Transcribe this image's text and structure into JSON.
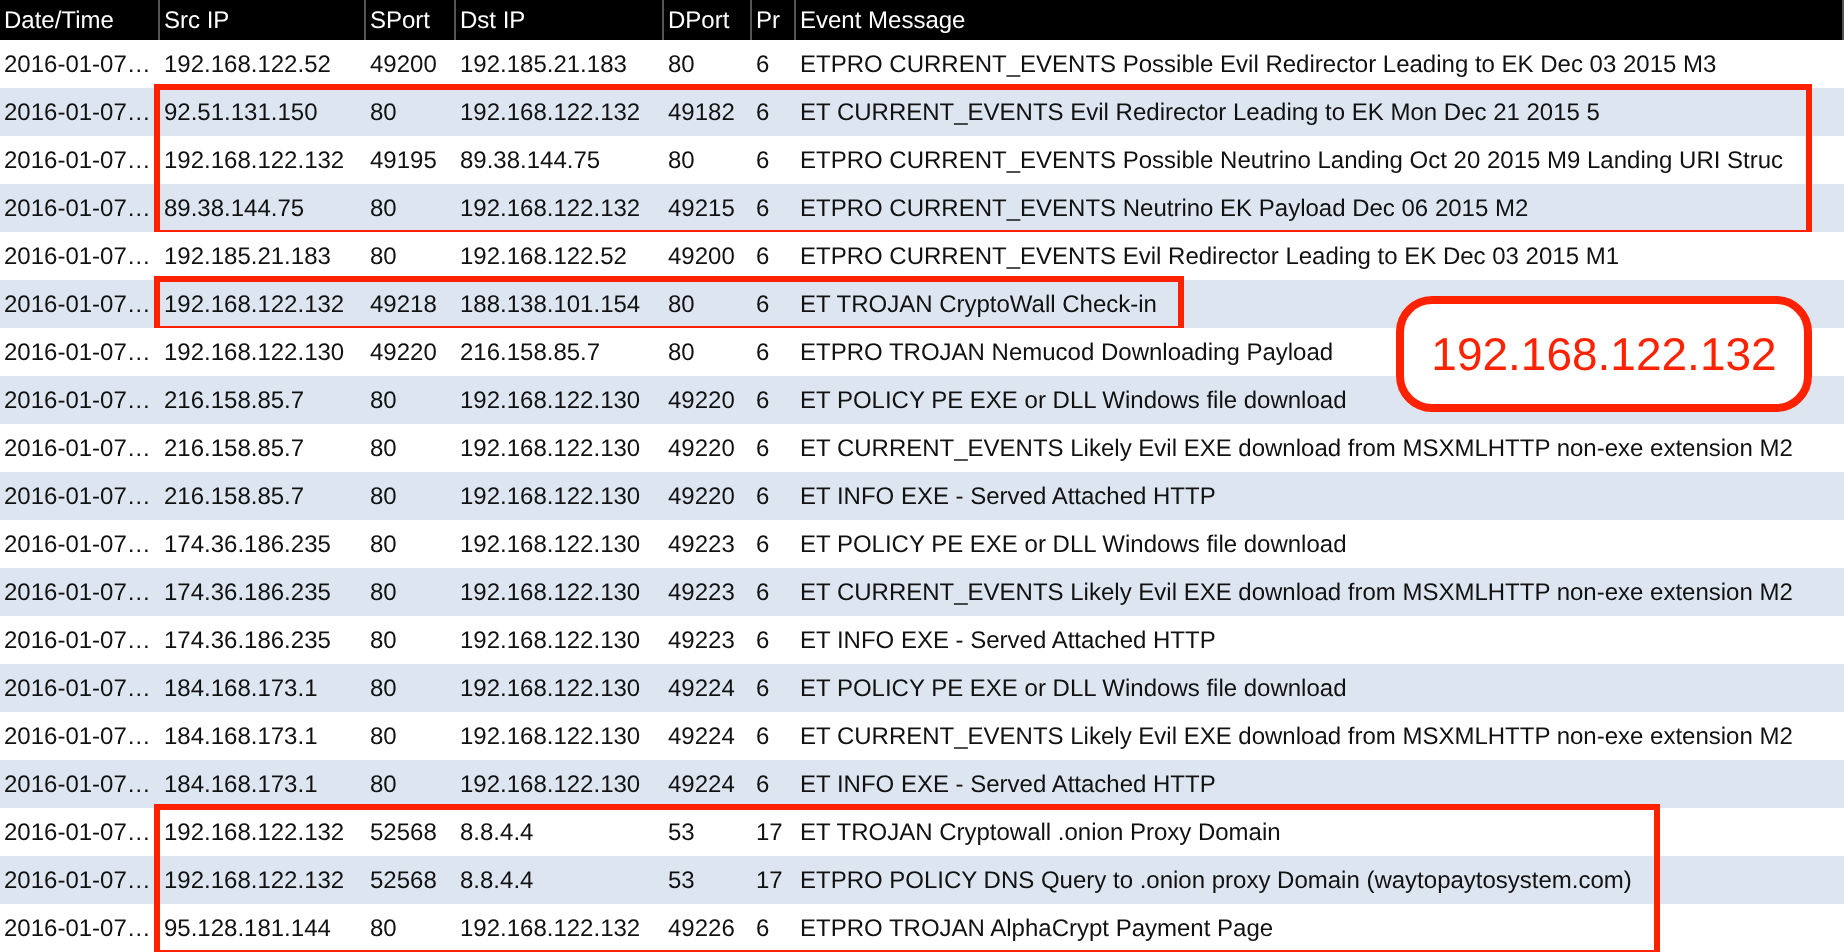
{
  "table": {
    "columns": [
      "Date/Time",
      "Src IP",
      "SPort",
      "Dst IP",
      "DPort",
      "Pr",
      "Event Message"
    ],
    "groups": [
      {
        "outlined": false,
        "rows": [
          [
            "2016-01-07…",
            "192.168.122.52",
            "49200",
            "192.185.21.183",
            "80",
            "6",
            "ETPRO CURRENT_EVENTS Possible Evil Redirector Leading to EK Dec 03 2015 M3"
          ]
        ]
      },
      {
        "outlined": true,
        "rows": [
          [
            "2016-01-07…",
            "92.51.131.150",
            "80",
            "192.168.122.132",
            "49182",
            "6",
            "ET CURRENT_EVENTS Evil Redirector Leading to EK Mon Dec 21 2015 5"
          ],
          [
            "2016-01-07…",
            "192.168.122.132",
            "49195",
            "89.38.144.75",
            "80",
            "6",
            "ETPRO CURRENT_EVENTS Possible Neutrino Landing Oct 20 2015 M9 Landing URI Struc"
          ],
          [
            "2016-01-07…",
            "89.38.144.75",
            "80",
            "192.168.122.132",
            "49215",
            "6",
            "ETPRO CURRENT_EVENTS Neutrino EK Payload Dec 06 2015 M2"
          ]
        ]
      },
      {
        "outlined": false,
        "rows": [
          [
            "2016-01-07…",
            "192.185.21.183",
            "80",
            "192.168.122.52",
            "49200",
            "6",
            "ETPRO CURRENT_EVENTS Evil Redirector Leading to EK Dec 03 2015 M1"
          ]
        ]
      },
      {
        "outlined": true,
        "rows": [
          [
            "2016-01-07…",
            "192.168.122.132",
            "49218",
            "188.138.101.154",
            "80",
            "6",
            "ET TROJAN CryptoWall Check-in"
          ]
        ]
      },
      {
        "outlined": false,
        "rows": [
          [
            "2016-01-07…",
            "192.168.122.130",
            "49220",
            "216.158.85.7",
            "80",
            "6",
            "ETPRO TROJAN Nemucod Downloading Payload"
          ],
          [
            "2016-01-07…",
            "216.158.85.7",
            "80",
            "192.168.122.130",
            "49220",
            "6",
            "ET POLICY PE EXE or DLL Windows file download"
          ],
          [
            "2016-01-07…",
            "216.158.85.7",
            "80",
            "192.168.122.130",
            "49220",
            "6",
            "ET CURRENT_EVENTS Likely Evil EXE download from MSXMLHTTP non-exe extension M2"
          ],
          [
            "2016-01-07…",
            "216.158.85.7",
            "80",
            "192.168.122.130",
            "49220",
            "6",
            "ET INFO EXE - Served Attached HTTP"
          ],
          [
            "2016-01-07…",
            "174.36.186.235",
            "80",
            "192.168.122.130",
            "49223",
            "6",
            "ET POLICY PE EXE or DLL Windows file download"
          ],
          [
            "2016-01-07…",
            "174.36.186.235",
            "80",
            "192.168.122.130",
            "49223",
            "6",
            "ET CURRENT_EVENTS Likely Evil EXE download from MSXMLHTTP non-exe extension M2"
          ],
          [
            "2016-01-07…",
            "174.36.186.235",
            "80",
            "192.168.122.130",
            "49223",
            "6",
            "ET INFO EXE - Served Attached HTTP"
          ],
          [
            "2016-01-07…",
            "184.168.173.1",
            "80",
            "192.168.122.130",
            "49224",
            "6",
            "ET POLICY PE EXE or DLL Windows file download"
          ],
          [
            "2016-01-07…",
            "184.168.173.1",
            "80",
            "192.168.122.130",
            "49224",
            "6",
            "ET CURRENT_EVENTS Likely Evil EXE download from MSXMLHTTP non-exe extension M2"
          ],
          [
            "2016-01-07…",
            "184.168.173.1",
            "80",
            "192.168.122.130",
            "49224",
            "6",
            "ET INFO EXE - Served Attached HTTP"
          ]
        ]
      },
      {
        "outlined": true,
        "rows": [
          [
            "2016-01-07…",
            "192.168.122.132",
            "52568",
            "8.8.4.4",
            "53",
            "17",
            "ET TROJAN Cryptowall .onion Proxy Domain"
          ],
          [
            "2016-01-07…",
            "192.168.122.132",
            "52568",
            "8.8.4.4",
            "53",
            "17",
            "ETPRO POLICY DNS Query to .onion proxy Domain (waytopaytosystem.com)"
          ],
          [
            "2016-01-07…",
            "95.128.181.144",
            "80",
            "192.168.122.132",
            "49226",
            "6",
            "ETPRO TROJAN AlphaCrypt Payment Page"
          ]
        ]
      }
    ]
  },
  "callout": {
    "text": "192.168.122.132"
  }
}
